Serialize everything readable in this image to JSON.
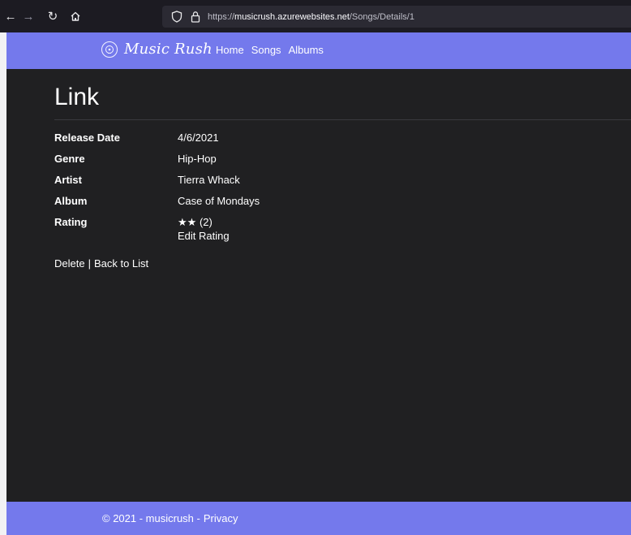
{
  "browser": {
    "back_icon": "←",
    "forward_icon": "→",
    "reload_icon": "↻",
    "url_prefix": "https://",
    "url_host": "musicrush.azurewebsites.net",
    "url_path": "/Songs/Details/1"
  },
  "nav": {
    "brand": "Music Rush",
    "links": [
      "Home",
      "Songs",
      "Albums"
    ]
  },
  "page": {
    "title": "Link"
  },
  "details": {
    "release_date_label": "Release Date",
    "release_date": "4/6/2021",
    "genre_label": "Genre",
    "genre": "Hip-Hop",
    "artist_label": "Artist",
    "artist": "Tierra Whack",
    "album_label": "Album",
    "album": "Case of Mondays",
    "rating_label": "Rating",
    "rating_stars": "★★",
    "rating_count": "(2)",
    "edit_rating": "Edit Rating"
  },
  "actions": {
    "delete": "Delete",
    "separator": "|",
    "back": "Back to List"
  },
  "footer": {
    "copyright": "© 2021 - musicrush -",
    "privacy": "Privacy"
  },
  "colors": {
    "accent": "#7479ec",
    "content_bg": "#202022",
    "toolbar_bg": "#1c1b22"
  }
}
